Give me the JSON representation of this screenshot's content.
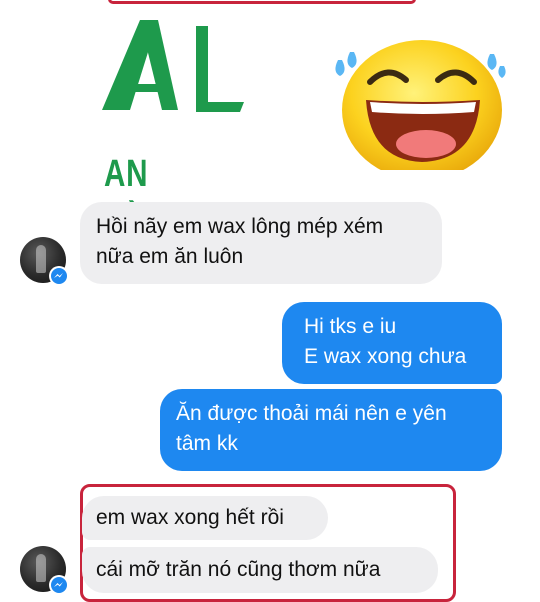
{
  "brand": {
    "logo_letters": "AL",
    "name": "AN LÀNH",
    "color": "#1e9a4c"
  },
  "decoration": {
    "emoji": "laughing-tears-emoji"
  },
  "colors": {
    "incoming_bubble": "#eeeef0",
    "outgoing_bubble": "#1e88f0",
    "highlight": "#c8243c",
    "messenger_badge": "#1e88f0"
  },
  "messages": [
    {
      "direction": "incoming",
      "lines": [
        "Hồi nãy em wax lông mép xém",
        "nữa em ăn luôn"
      ]
    },
    {
      "direction": "outgoing",
      "lines": [
        "Hi tks e iu",
        "E wax xong chưa"
      ]
    },
    {
      "direction": "outgoing",
      "lines": [
        "Ăn được thoải mái nên e yên",
        "tâm kk"
      ]
    },
    {
      "direction": "incoming",
      "lines": [
        "em wax xong hết rồi"
      ]
    },
    {
      "direction": "incoming",
      "lines": [
        "cái mỡ trăn nó cũng thơm nữa"
      ]
    }
  ]
}
